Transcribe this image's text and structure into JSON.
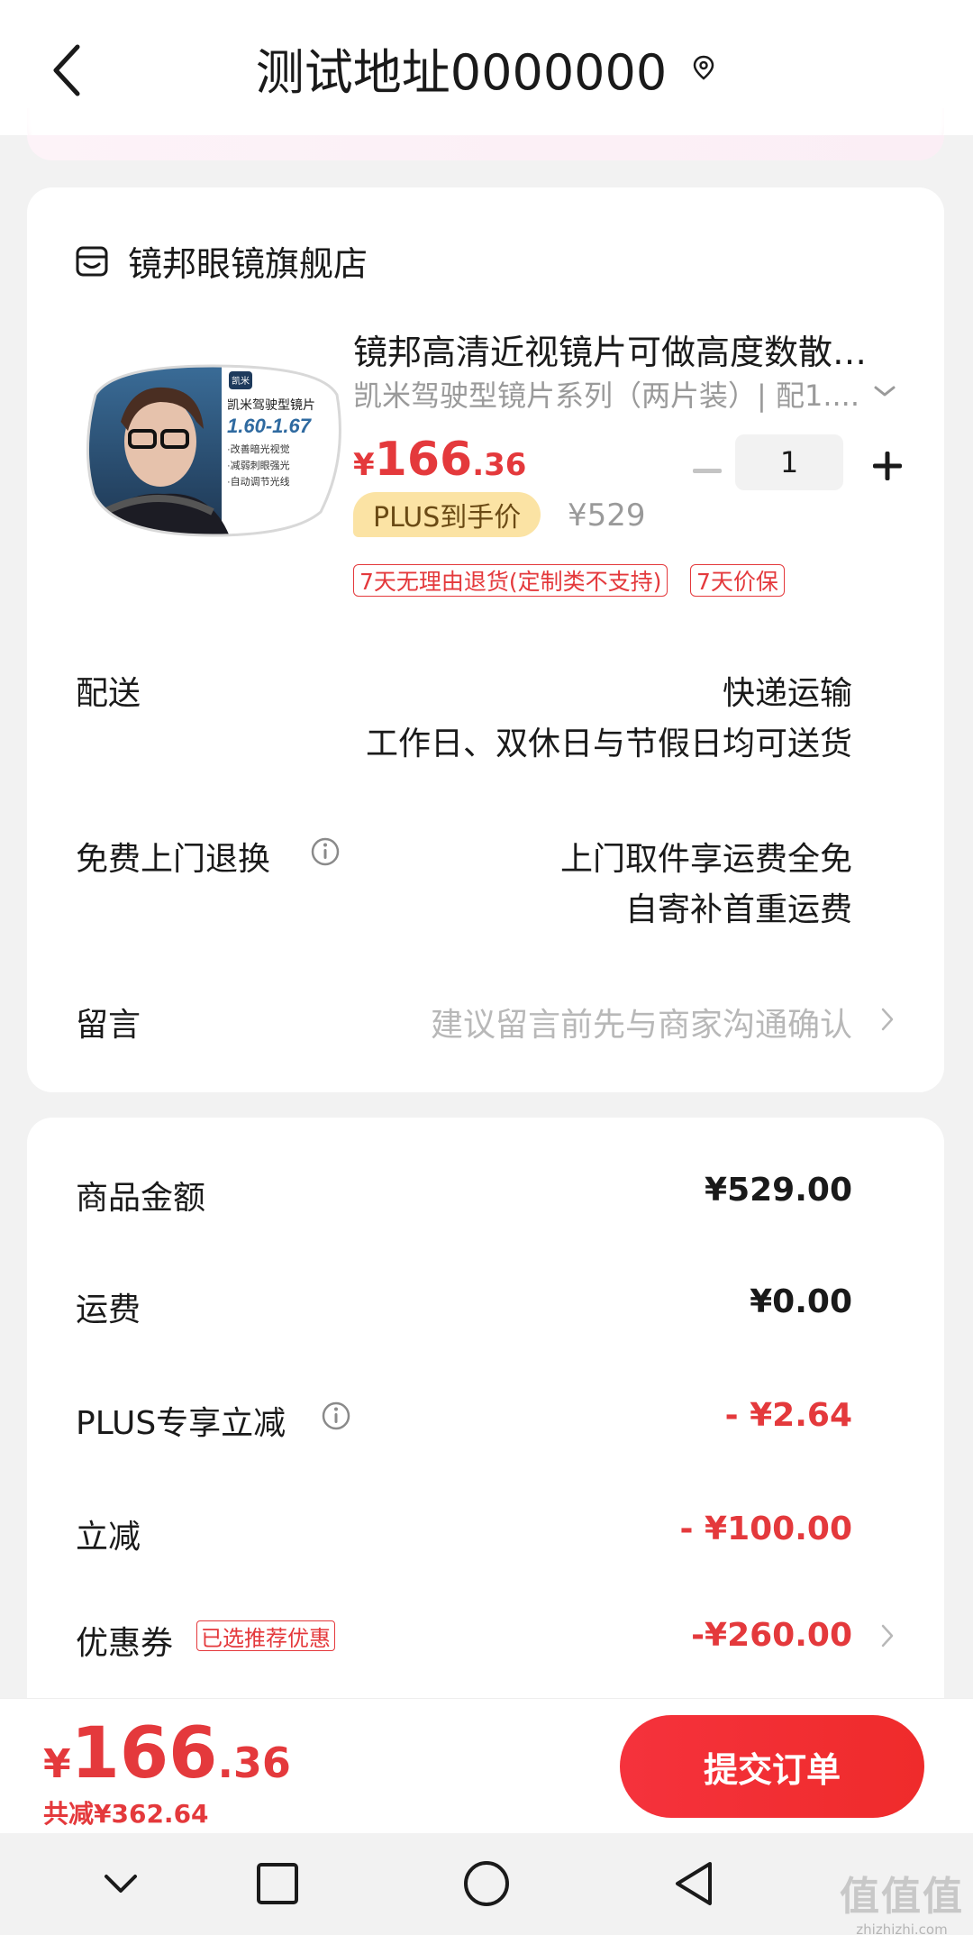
{
  "header": {
    "title": "测试地址0000000"
  },
  "shop": {
    "name": "镜邦眼镜旗舰店"
  },
  "product": {
    "title": "镜邦高清近视镜片可做高度数散…",
    "spec": "凯米驾驶型镜片系列（两片装）| 配1....",
    "price_symbol": "¥",
    "price_int": "166",
    "price_dec": ".36",
    "quantity": "1",
    "plus_badge": "PLUS到手价",
    "original_price": "¥529",
    "tags": [
      "7天无理由退货(定制类不支持)",
      "7天价保"
    ],
    "image_text": {
      "brand": "凯米",
      "name": "凯米驾驶型镜片",
      "index": "1.60-1.67",
      "features": [
        "·改善暗光视觉",
        "·减弱刺眼强光",
        "·自动调节光线"
      ]
    }
  },
  "delivery": {
    "label": "配送",
    "value_line1": "快递运输",
    "value_line2": "工作日、双休日与节假日均可送货"
  },
  "return_service": {
    "label": "免费上门退换",
    "value_line1": "上门取件享运费全免",
    "value_line2": "自寄补首重运费"
  },
  "message": {
    "label": "留言",
    "placeholder": "建议留言前先与商家沟通确认"
  },
  "summary": {
    "goods_amount_label": "商品金额",
    "goods_amount": "¥529.00",
    "shipping_label": "运费",
    "shipping": "¥0.00",
    "plus_discount_label": "PLUS专享立减",
    "plus_discount": "- ¥2.64",
    "instant_discount_label": "立减",
    "instant_discount": "- ¥100.00",
    "coupon_label": "优惠券",
    "coupon_tag": "已选推荐优惠",
    "coupon": "-¥260.00"
  },
  "bottom": {
    "total_symbol": "¥",
    "total_int": "166",
    "total_dec": ".36",
    "total_saved": "共减¥362.64",
    "submit_label": "提交订单"
  },
  "watermark": {
    "logo": "值值值",
    "url": "zhizhizhi.com"
  },
  "colors": {
    "accent": "#e4393c",
    "plus_badge_bg": "#fbe3a4"
  }
}
